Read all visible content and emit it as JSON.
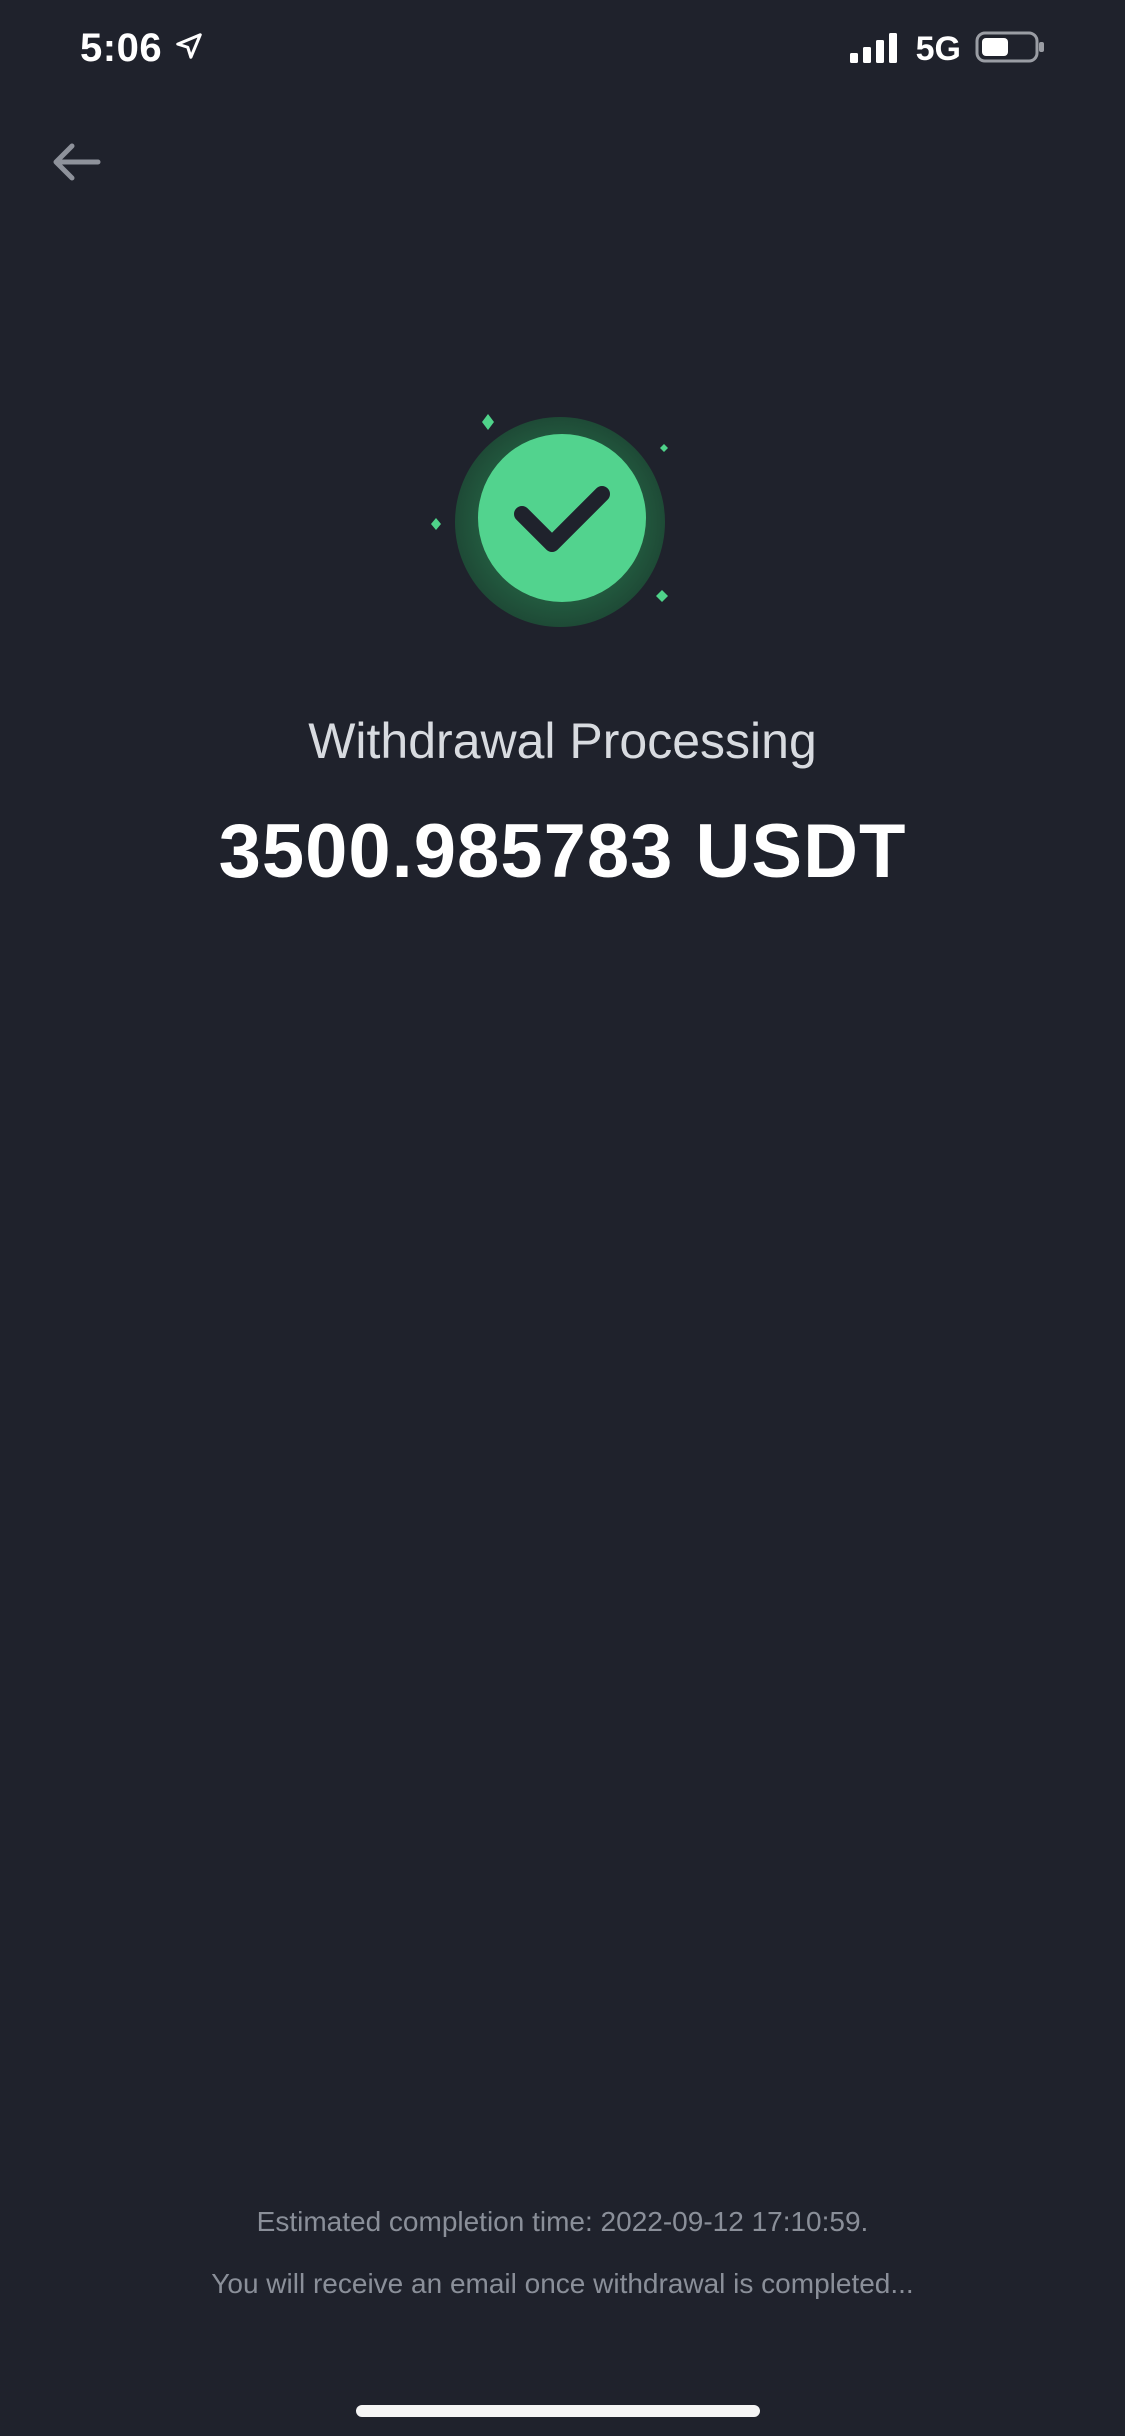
{
  "status_bar": {
    "time": "5:06",
    "network": "5G",
    "icons": [
      "location-arrow-icon",
      "signal-icon",
      "battery-icon"
    ]
  },
  "header": {
    "back_icon": "back-arrow-icon"
  },
  "result": {
    "icon": "check-circle-icon",
    "title": "Withdrawal Processing",
    "amount": "3500.985783 USDT"
  },
  "footer": {
    "eta": "Estimated completion time: 2022-09-12 17:10:59.",
    "email_notice": "You will receive an email once withdrawal is completed..."
  },
  "colors": {
    "background": "#1f222c",
    "success_green": "#4fd38a",
    "text_primary": "#ffffff",
    "text_secondary": "#8a8f99"
  }
}
